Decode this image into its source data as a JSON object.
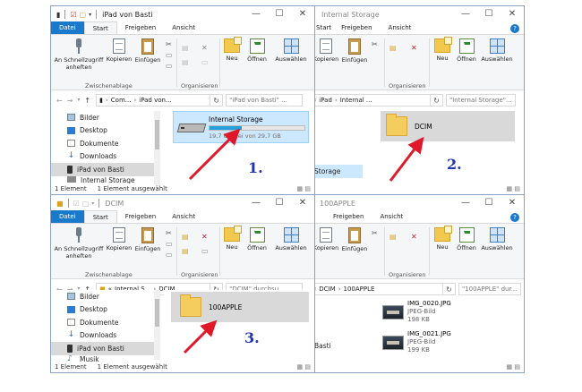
{
  "common": {
    "tabs": [
      "Datei",
      "Start",
      "Freigeben",
      "Ansicht"
    ],
    "ribbon": {
      "pin_label": "An Schnellzugriff anheften",
      "pin_label_line1": "An Schnellzugriff",
      "pin_label_line2": "anheften",
      "copy_label": "Kopieren",
      "paste_label": "Einfügen",
      "new_label": "Neu",
      "open_label": "Öffnen",
      "select_label": "Auswählen",
      "clipboard_group": "Zwischenablage",
      "organize_group": "Organisieren"
    },
    "window_controls": [
      "—",
      "☐",
      "✕"
    ],
    "help": "?"
  },
  "windows": {
    "w1": {
      "title": "iPad von Basti",
      "path": [
        "Com...",
        "iPad von..."
      ],
      "search_placeholder": "\"iPad von Basti\" ...",
      "nav_items": [
        "Bilder",
        "Desktop",
        "Dokumente",
        "Downloads",
        "iPad von Basti",
        "Internal Storage"
      ],
      "selected_nav": "iPad von Basti",
      "drive": {
        "name": "Internal Storage",
        "free": "19,7 GB frei von 29,7 GB",
        "used_fraction": 0.34
      },
      "status": [
        "1 Element",
        "1 Element ausgewählt"
      ],
      "step": "1."
    },
    "w2": {
      "title": "Internal Storage",
      "path": [
        "«",
        "iPad",
        "Internal ..."
      ],
      "search_placeholder": "\"Internal Storage\"...",
      "nav_partial": [
        "Storage"
      ],
      "folder": "DCIM",
      "step": "2."
    },
    "w3": {
      "title": "DCIM",
      "path": [
        "«",
        "Internal S...",
        "DCIM"
      ],
      "search_placeholder": "\"DCIM\" durchsu...",
      "nav_items": [
        "Bilder",
        "Desktop",
        "Dokumente",
        "Downloads",
        "iPad von Basti",
        "Musik"
      ],
      "selected_nav": "iPad von Basti",
      "folder": "100APPLE",
      "status": [
        "1 Element",
        "1 Element ausgewählt"
      ],
      "step": "3."
    },
    "w4": {
      "title": "100APPLE",
      "path": [
        "«",
        "DCIM",
        "100APPLE"
      ],
      "search_placeholder": "\"100APPLE\" dur...",
      "nav_partial": [
        "Basti"
      ],
      "files": [
        {
          "name": "IMG_0020.JPG",
          "type": "JPEG-Bild",
          "size": "198 KB"
        },
        {
          "name": "IMG_0021.JPG",
          "type": "JPEG-Bild",
          "size": "199 KB"
        }
      ]
    }
  },
  "colors": {
    "accent": "#1979ca",
    "arrow": "#e0192a",
    "step": "#2134b3",
    "selection": "#d9d9d9"
  }
}
